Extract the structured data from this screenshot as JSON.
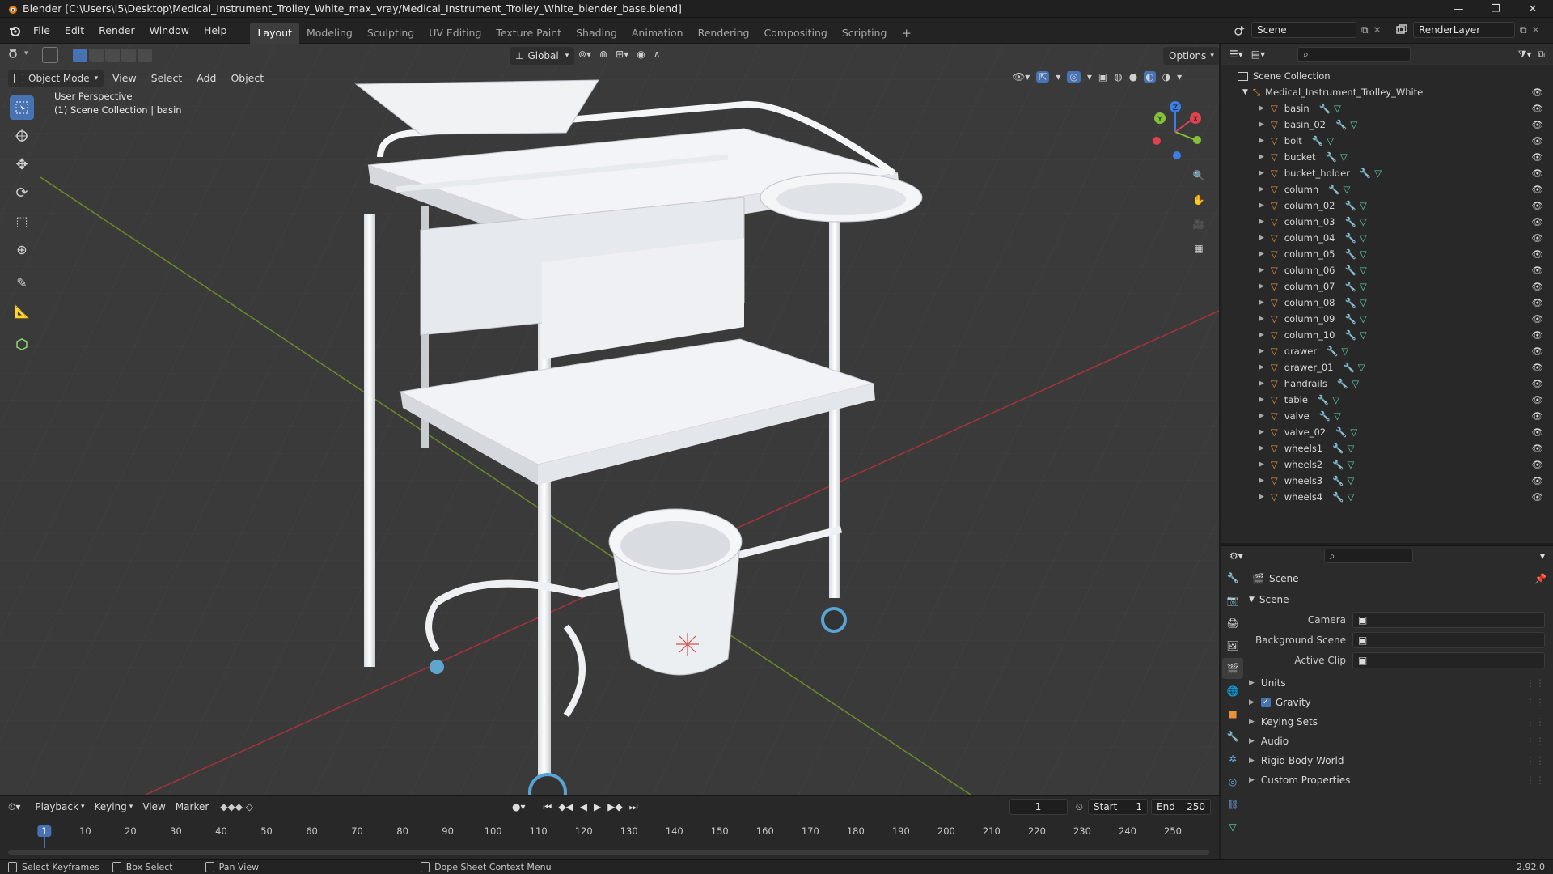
{
  "window": {
    "title": "Blender [C:\\Users\\I5\\Desktop\\Medical_Instrument_Trolley_White_max_vray/Medical_Instrument_Trolley_White_blender_base.blend]"
  },
  "menu": [
    "File",
    "Edit",
    "Render",
    "Window",
    "Help"
  ],
  "workspaces": [
    {
      "label": "Layout",
      "active": true
    },
    {
      "label": "Modeling",
      "active": false
    },
    {
      "label": "Sculpting",
      "active": false
    },
    {
      "label": "UV Editing",
      "active": false
    },
    {
      "label": "Texture Paint",
      "active": false
    },
    {
      "label": "Shading",
      "active": false
    },
    {
      "label": "Animation",
      "active": false
    },
    {
      "label": "Rendering",
      "active": false
    },
    {
      "label": "Compositing",
      "active": false
    },
    {
      "label": "Scripting",
      "active": false
    }
  ],
  "add_workspace": "+",
  "scene_selector": {
    "value": "Scene"
  },
  "layer_selector": {
    "value": "RenderLayer"
  },
  "viewport": {
    "mode": "Object Mode",
    "menu": [
      "View",
      "Select",
      "Add",
      "Object"
    ],
    "transform_orientation": "Global",
    "options_label": "Options",
    "overlay_line1": "User Perspective",
    "overlay_line2": "(1) Scene Collection | basin",
    "gizmo_labels": {
      "x": "X",
      "y": "Y",
      "z": "Z"
    }
  },
  "outliner": {
    "root": "Scene Collection",
    "collection": "Medical_Instrument_Trolley_White",
    "objects": [
      "basin",
      "basin_02",
      "bolt",
      "bucket",
      "bucket_holder",
      "column",
      "column_02",
      "column_03",
      "column_04",
      "column_05",
      "column_06",
      "column_07",
      "column_08",
      "column_09",
      "column_10",
      "drawer",
      "drawer_01",
      "handrails",
      "table",
      "valve",
      "valve_02",
      "wheels1",
      "wheels2",
      "wheels3",
      "wheels4"
    ]
  },
  "properties": {
    "context_title": "Scene",
    "panel_title": "Scene",
    "fields": [
      {
        "label": "Camera",
        "value": ""
      },
      {
        "label": "Background Scene",
        "value": ""
      },
      {
        "label": "Active Clip",
        "value": ""
      }
    ],
    "subpanels": [
      {
        "label": "Units",
        "checkbox": false
      },
      {
        "label": "Gravity",
        "checkbox": true
      },
      {
        "label": "Keying Sets",
        "checkbox": false
      },
      {
        "label": "Audio",
        "checkbox": false
      },
      {
        "label": "Rigid Body World",
        "checkbox": false
      },
      {
        "label": "Custom Properties",
        "checkbox": false
      }
    ]
  },
  "timeline": {
    "menu": [
      "Playback",
      "Keying",
      "View",
      "Marker"
    ],
    "current_frame": "1",
    "start_label": "Start",
    "start": "1",
    "end_label": "End",
    "end": "250",
    "ticks": [
      "1",
      "10",
      "20",
      "30",
      "40",
      "50",
      "60",
      "70",
      "80",
      "90",
      "100",
      "110",
      "120",
      "130",
      "140",
      "150",
      "160",
      "170",
      "180",
      "190",
      "200",
      "210",
      "220",
      "230",
      "240",
      "250"
    ]
  },
  "statusbar": {
    "items": [
      "Select Keyframes",
      "Box Select",
      "Pan View",
      "Dope Sheet Context Menu"
    ],
    "version": "2.92.0"
  },
  "colors": {
    "accent": "#4772b3",
    "object_icon": "#e8903c",
    "mesh_icon": "#5fd4a8",
    "modifier_icon": "#6ea8e8",
    "x_axis": "#e0434f",
    "y_axis": "#86c13a",
    "z_axis": "#3b7ee6"
  }
}
